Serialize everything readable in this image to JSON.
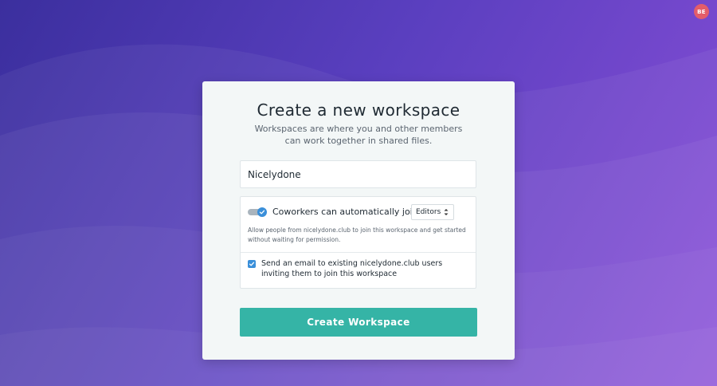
{
  "user": {
    "initials": "BE",
    "avatar_color": "#e35d6a"
  },
  "card": {
    "title": "Create a new workspace",
    "subtitle": "Workspaces are where you and other members can work together in shared files.",
    "workspace_name": {
      "value": "Nicelydone"
    },
    "auto_join": {
      "enabled": true,
      "label": "Coworkers can automatically join as",
      "role_selected": "Editors",
      "help": "Allow people from nicelydone.club to join this workspace and get started without waiting for permission."
    },
    "email_invite": {
      "checked": true,
      "label": "Send an email to existing nicelydone.club users inviting them to join this workspace"
    },
    "submit_label": "Create Workspace"
  },
  "colors": {
    "accent": "#35b4a6",
    "toggle_on": "#3a8fd9",
    "background_start": "#3b2f9e",
    "background_end": "#8a4fd8"
  },
  "icons": {
    "toggle_check": "check-icon",
    "checkbox_check": "check-icon",
    "select_arrows": "sort-arrows-icon"
  }
}
